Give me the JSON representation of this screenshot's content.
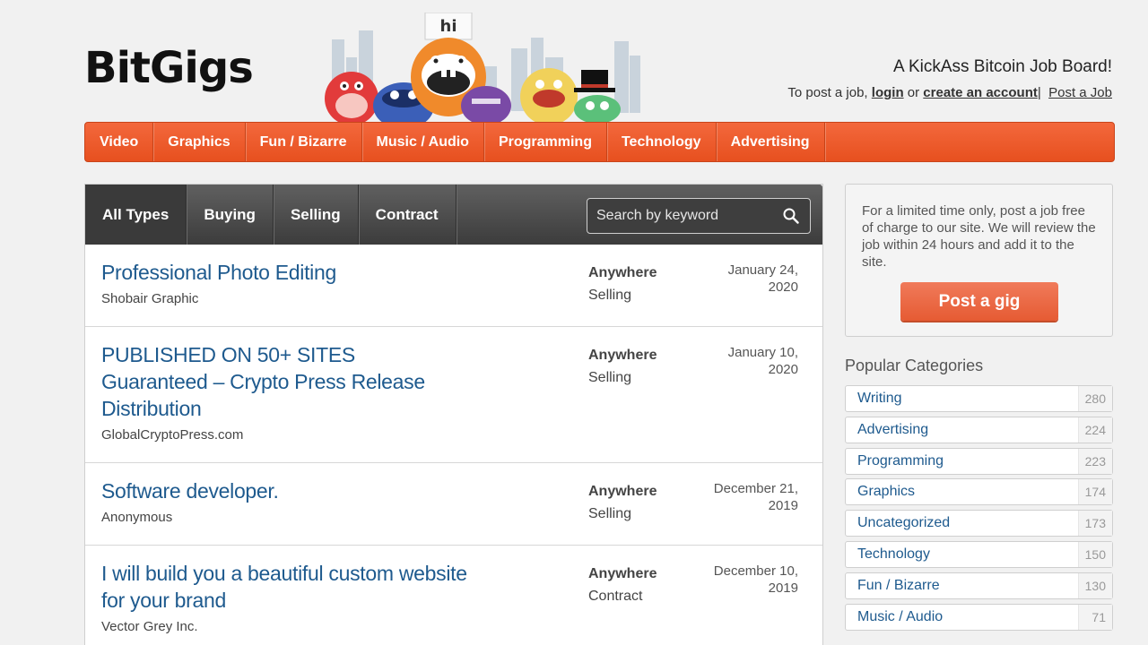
{
  "header": {
    "logo": "BitGigs",
    "mascot_sign": "hi",
    "tagline": "A KickAss Bitcoin Job Board!",
    "post_prefix": "To post a job,",
    "login": "login",
    "or": "or",
    "create_account": "create an account",
    "separator": "|",
    "post_job": "Post a Job"
  },
  "nav": {
    "items": [
      "Video",
      "Graphics",
      "Fun / Bizarre",
      "Music / Audio",
      "Programming",
      "Technology",
      "Advertising"
    ]
  },
  "listing": {
    "tabs": [
      "All Types",
      "Buying",
      "Selling",
      "Contract"
    ],
    "active_tab": "All Types",
    "search_placeholder": "Search by keyword",
    "jobs": [
      {
        "title": "Professional Photo Editing",
        "company": "Shobair Graphic",
        "location": "Anywhere",
        "type": "Selling",
        "date": "January 24, 2020"
      },
      {
        "title": "PUBLISHED ON 50+ SITES Guaranteed – Crypto Press Release Distribution",
        "company": "GlobalCryptoPress.com",
        "location": "Anywhere",
        "type": "Selling",
        "date": "January 10, 2020"
      },
      {
        "title": "Software developer.",
        "company": "Anonymous",
        "location": "Anywhere",
        "type": "Selling",
        "date": "December 21, 2019"
      },
      {
        "title": "I will build you a beautiful custom website for your brand",
        "company": "Vector Grey Inc.",
        "location": "Anywhere",
        "type": "Contract",
        "date": "December 10, 2019"
      }
    ]
  },
  "sidebar": {
    "promo_text": "For a limited time only, post a job free of charge to our site. We will review the job within 24 hours and add it to the site.",
    "promo_button": "Post a gig",
    "categories_heading": "Popular Categories",
    "categories": [
      {
        "name": "Writing",
        "count": "280"
      },
      {
        "name": "Advertising",
        "count": "224"
      },
      {
        "name": "Programming",
        "count": "223"
      },
      {
        "name": "Graphics",
        "count": "174"
      },
      {
        "name": "Uncategorized",
        "count": "173"
      },
      {
        "name": "Technology",
        "count": "150"
      },
      {
        "name": "Fun / Bizarre",
        "count": "130"
      },
      {
        "name": "Music / Audio",
        "count": "71"
      }
    ]
  },
  "colors": {
    "nav_orange": "#ec5a2b",
    "link_blue": "#1e5a8e",
    "promo_button": "#e86a45"
  }
}
